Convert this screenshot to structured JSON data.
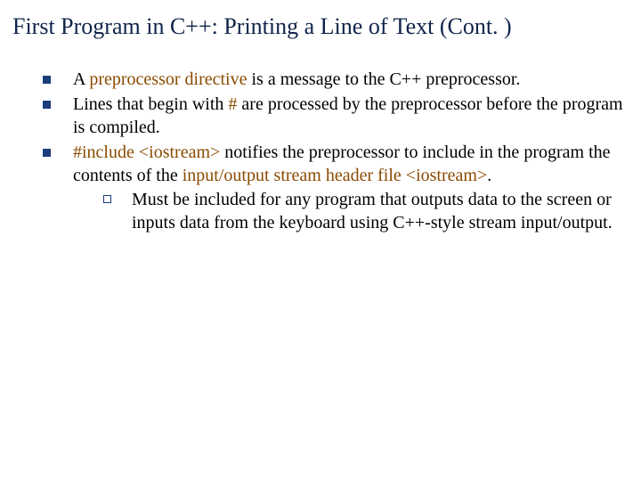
{
  "title": "First Program in C++: Printing a Line of Text (Cont. )",
  "bullets": [
    {
      "pre": "A ",
      "term": "preprocessor directive",
      "post": " is a message to the C++ preprocessor."
    },
    {
      "pre": "Lines that begin with ",
      "term": "#",
      "post": " are processed by the preprocessor before the program is compiled."
    },
    {
      "pre": "",
      "term": "#include <iostream>",
      "mid": " notifies the preprocessor to include in the program the contents of the ",
      "term2": "input/output stream header file <iostream>",
      "post": ".",
      "sub": "Must be included for any program that outputs data to the screen or inputs data from the keyboard using C++-style stream input/output."
    }
  ]
}
